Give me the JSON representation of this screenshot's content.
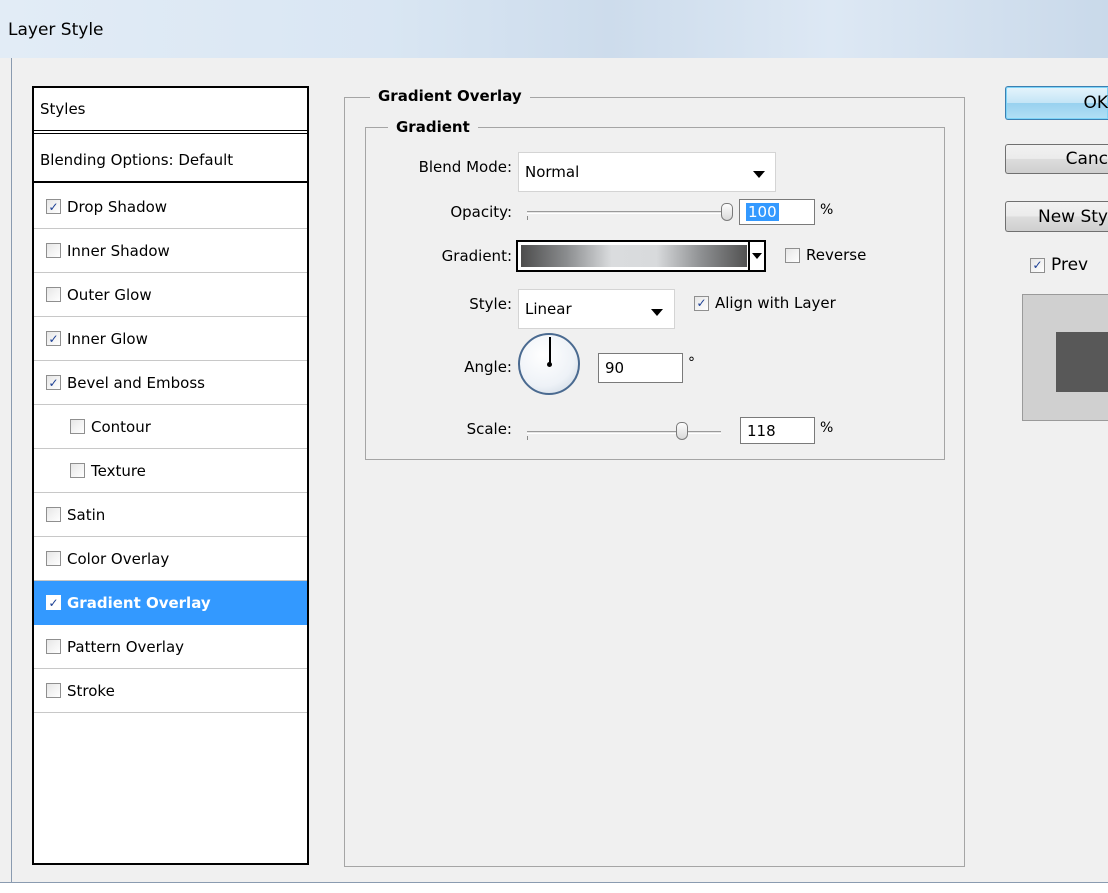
{
  "window": {
    "title": "Layer Style"
  },
  "styles_panel": {
    "header": "Styles",
    "blending_options": "Blending Options: Default",
    "items": [
      {
        "label": "Drop Shadow",
        "checked": true,
        "indent": false,
        "selected": false
      },
      {
        "label": "Inner Shadow",
        "checked": false,
        "indent": false,
        "selected": false
      },
      {
        "label": "Outer Glow",
        "checked": false,
        "indent": false,
        "selected": false
      },
      {
        "label": "Inner Glow",
        "checked": true,
        "indent": false,
        "selected": false
      },
      {
        "label": "Bevel and Emboss",
        "checked": true,
        "indent": false,
        "selected": false
      },
      {
        "label": "Contour",
        "checked": false,
        "indent": true,
        "selected": false
      },
      {
        "label": "Texture",
        "checked": false,
        "indent": true,
        "selected": false
      },
      {
        "label": "Satin",
        "checked": false,
        "indent": false,
        "selected": false
      },
      {
        "label": "Color Overlay",
        "checked": false,
        "indent": false,
        "selected": false
      },
      {
        "label": "Gradient Overlay",
        "checked": true,
        "indent": false,
        "selected": true
      },
      {
        "label": "Pattern Overlay",
        "checked": false,
        "indent": false,
        "selected": false
      },
      {
        "label": "Stroke",
        "checked": false,
        "indent": false,
        "selected": false
      }
    ]
  },
  "gradient_overlay": {
    "section_title": "Gradient Overlay",
    "group_title": "Gradient",
    "blend_mode": {
      "label": "Blend Mode:",
      "value": "Normal"
    },
    "opacity": {
      "label": "Opacity:",
      "value": "100",
      "unit": "%",
      "level": 1.0
    },
    "gradient": {
      "label": "Gradient:",
      "reverse_label": "Reverse",
      "reverse_checked": false,
      "colors": [
        "#4d4d4d",
        "#8a8c8e",
        "#dadcde",
        "#d8dadc",
        "#8d8f91",
        "#525252"
      ]
    },
    "style": {
      "label": "Style:",
      "value": "Linear",
      "align_label": "Align with Layer",
      "align_checked": true
    },
    "angle": {
      "label": "Angle:",
      "value": "90",
      "unit": "°"
    },
    "scale": {
      "label": "Scale:",
      "value": "118",
      "unit": "%",
      "level": 0.8
    }
  },
  "buttons": {
    "ok": "OK",
    "cancel": "Canc",
    "new_style": "New Sty",
    "preview": "Prev"
  },
  "preview": {
    "checked": true,
    "swatch_color": "#585858"
  },
  "colors": {
    "selection": "#3399ff",
    "check": "#1c3f94"
  }
}
